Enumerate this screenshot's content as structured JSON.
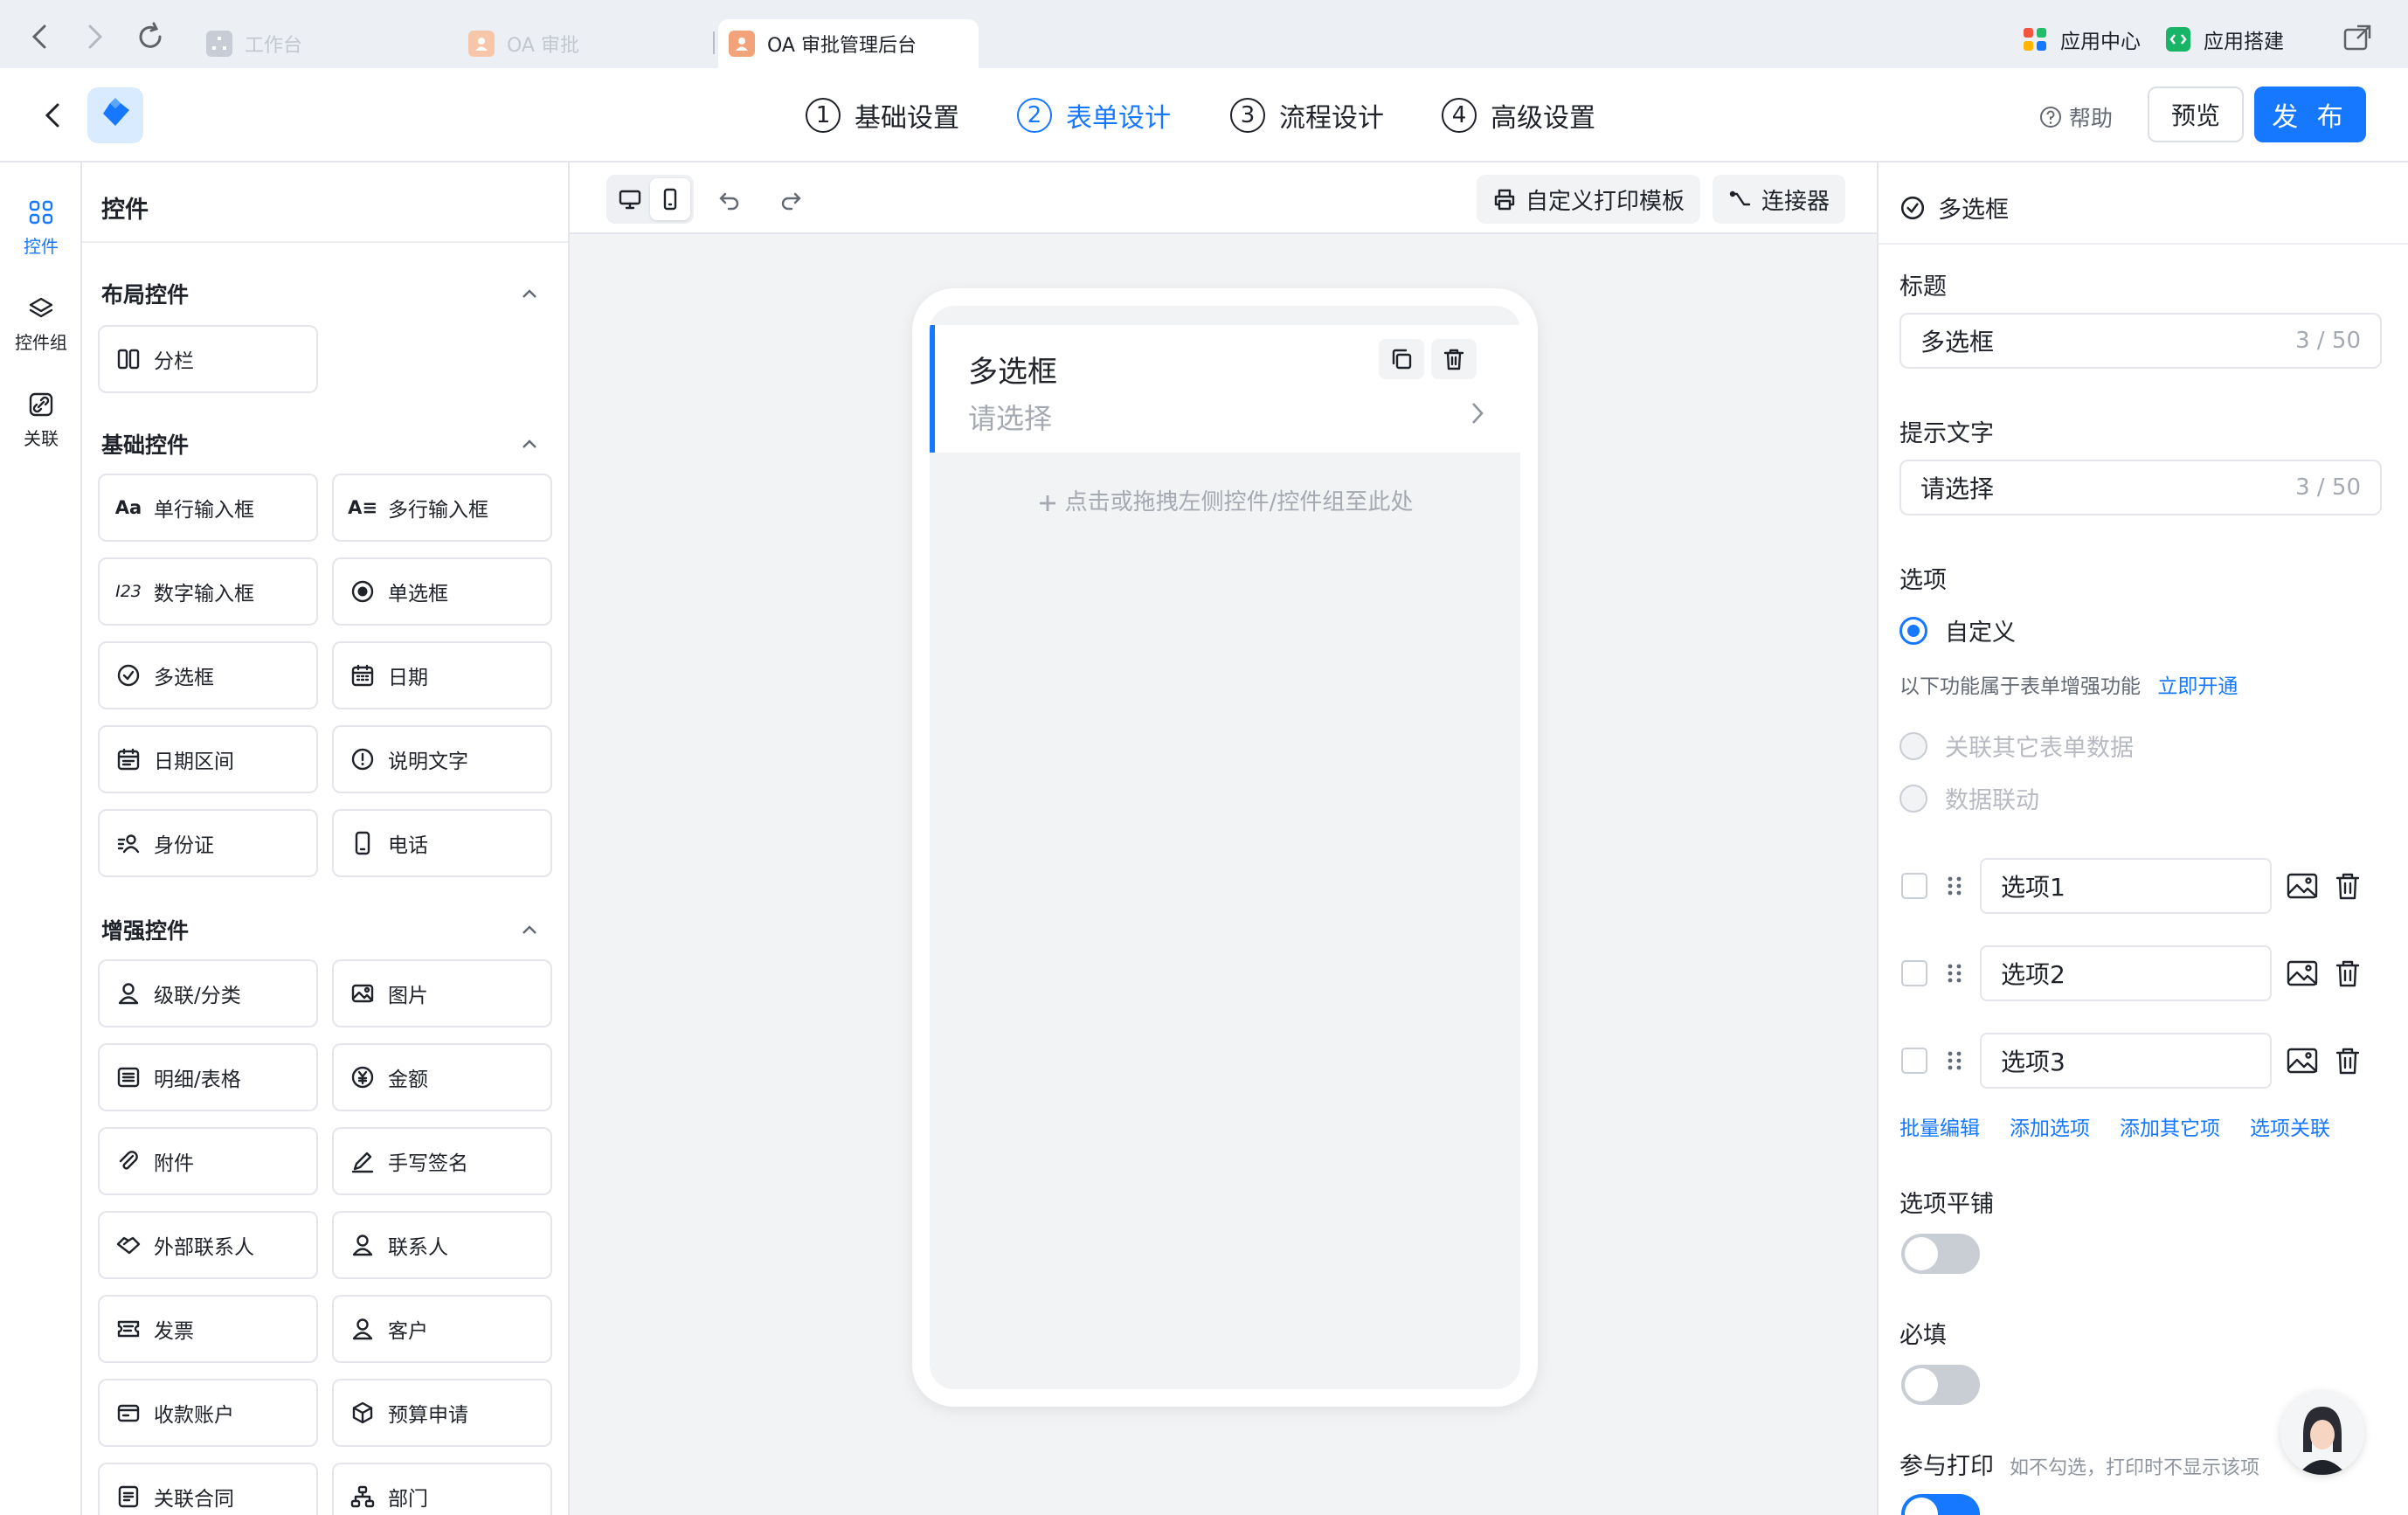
{
  "browser": {
    "tabs": [
      {
        "label": "工作台"
      },
      {
        "label": "OA 审批"
      },
      {
        "label": "OA 审批管理后台"
      }
    ],
    "right": {
      "app_center": "应用中心",
      "app_builder": "应用搭建"
    }
  },
  "header": {
    "steps": [
      {
        "num": "1",
        "label": "基础设置",
        "active": false
      },
      {
        "num": "2",
        "label": "表单设计",
        "active": true
      },
      {
        "num": "3",
        "label": "流程设计",
        "active": false
      },
      {
        "num": "4",
        "label": "高级设置",
        "active": false
      }
    ],
    "help": "帮助",
    "preview": "预览",
    "publish": "发 布"
  },
  "rail": {
    "items": [
      {
        "label": "控件"
      },
      {
        "label": "控件组"
      },
      {
        "label": "关联"
      }
    ]
  },
  "controls": {
    "title": "控件",
    "layout_title": "布局控件",
    "layout_items": [
      {
        "label": "分栏",
        "icon": "columns-icon"
      }
    ],
    "basic_title": "基础控件",
    "basic_items": [
      {
        "label": "单行输入框",
        "icon": "text-input-icon",
        "glyph": "Aa"
      },
      {
        "label": "多行输入框",
        "icon": "textarea-icon",
        "glyph": "A≡"
      },
      {
        "label": "数字输入框",
        "icon": "number-input-icon",
        "glyph": "I23"
      },
      {
        "label": "单选框",
        "icon": "radio-icon"
      },
      {
        "label": "多选框",
        "icon": "checkbox-icon"
      },
      {
        "label": "日期",
        "icon": "calendar-icon"
      },
      {
        "label": "日期区间",
        "icon": "date-range-icon"
      },
      {
        "label": "说明文字",
        "icon": "info-icon"
      },
      {
        "label": "身份证",
        "icon": "id-card-icon"
      },
      {
        "label": "电话",
        "icon": "phone-icon"
      }
    ],
    "enhanced_title": "增强控件",
    "enhanced_items": [
      {
        "label": "级联/分类",
        "icon": "cascade-icon"
      },
      {
        "label": "图片",
        "icon": "image-icon"
      },
      {
        "label": "明细/表格",
        "icon": "table-icon"
      },
      {
        "label": "金额",
        "icon": "money-icon"
      },
      {
        "label": "附件",
        "icon": "attachment-icon"
      },
      {
        "label": "手写签名",
        "icon": "signature-icon"
      },
      {
        "label": "外部联系人",
        "icon": "handshake-icon"
      },
      {
        "label": "联系人",
        "icon": "contact-icon"
      },
      {
        "label": "发票",
        "icon": "invoice-icon"
      },
      {
        "label": "客户",
        "icon": "customer-icon"
      },
      {
        "label": "收款账户",
        "icon": "account-icon"
      },
      {
        "label": "预算申请",
        "icon": "budget-icon"
      },
      {
        "label": "关联合同",
        "icon": "contract-icon"
      },
      {
        "label": "部门",
        "icon": "department-icon"
      }
    ]
  },
  "canvas": {
    "print_template": "自定义打印模板",
    "connector": "连接器",
    "field": {
      "title": "多选框",
      "placeholder": "请选择"
    },
    "drop_hint": "点击或拖拽左侧控件/控件组至此处"
  },
  "props": {
    "header": "多选框",
    "title_label": "标题",
    "title_value": "多选框",
    "title_count": "3 / 50",
    "hint_label": "提示文字",
    "hint_value": "请选择",
    "hint_count": "3 / 50",
    "options_label": "选项",
    "custom": "自定义",
    "enhance_note": "以下功能属于表单增强功能",
    "enable_now": "立即开通",
    "link_other": "关联其它表单数据",
    "linkage": "数据联动",
    "options": [
      {
        "value": "选项1"
      },
      {
        "value": "选项2"
      },
      {
        "value": "选项3"
      }
    ],
    "links": [
      "批量编辑",
      "添加选项",
      "添加其它项",
      "选项关联"
    ],
    "tile_label": "选项平铺",
    "tile_on": false,
    "required_label": "必填",
    "required_on": false,
    "print_label": "参与打印",
    "print_note": "如不勾选，打印时不显示该项",
    "print_on": true
  },
  "colors": {
    "accent": "#1677ff",
    "background": "#f2f3f5"
  }
}
